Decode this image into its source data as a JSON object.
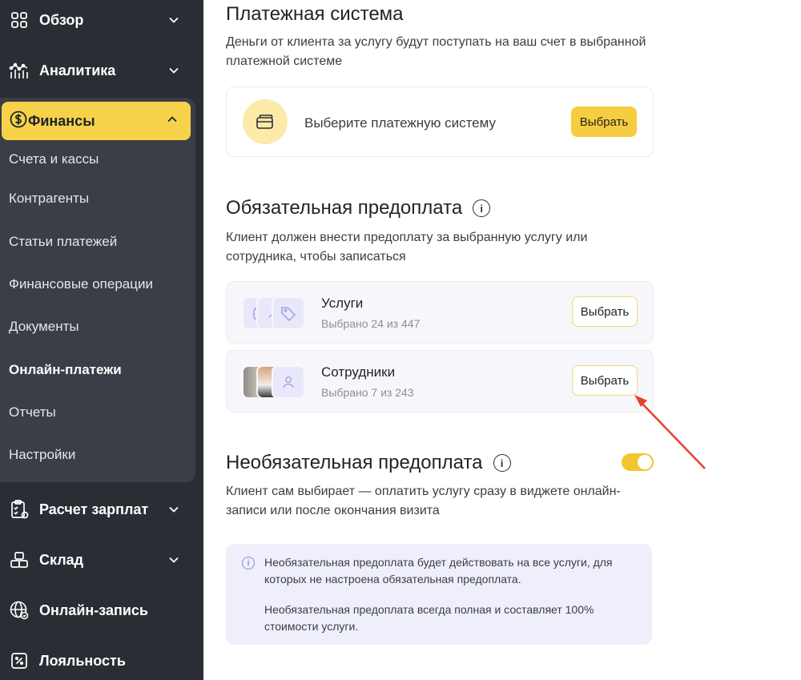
{
  "sidebar": {
    "items": [
      {
        "label": "Обзор",
        "icon": "grid-icon"
      },
      {
        "label": "Аналитика",
        "icon": "analytics-icon"
      },
      {
        "label": "Финансы",
        "icon": "dollar-coin-icon"
      },
      {
        "label": "Расчет зарплат",
        "icon": "clipboard-icon"
      },
      {
        "label": "Склад",
        "icon": "boxes-icon"
      },
      {
        "label": "Онлайн-запись",
        "icon": "globe-icon"
      },
      {
        "label": "Лояльность",
        "icon": "percent-icon"
      }
    ],
    "finance_sub": [
      "Счета и кассы",
      "Контрагенты",
      "Статьи платежей",
      "Финансовые операции",
      "Документы",
      "Онлайн-платежи",
      "Отчеты",
      "Настройки"
    ],
    "active_sub": "Онлайн-платежи"
  },
  "payment_system": {
    "title": "Платежная система",
    "description": "Деньги от клиента за услугу будут поступать на ваш счет в выбранной платежной системе",
    "card_text": "Выберите платежную систему",
    "button": "Выбрать"
  },
  "required_prepay": {
    "title": "Обязательная предоплата",
    "description": "Клиент должен внести предоплату за выбранную услугу или сотрудника, чтобы записаться",
    "rows": [
      {
        "title": "Услуги",
        "subtitle": "Выбрано 24 из 447",
        "button": "Выбрать"
      },
      {
        "title": "Сотрудники",
        "subtitle": "Выбрано 7 из 243",
        "button": "Выбрать"
      }
    ]
  },
  "optional_prepay": {
    "title": "Необязательная предоплата",
    "enabled": true,
    "description": "Клиент сам выбирает — оплатить услугу сразу в виджете онлайн-записи или после окончания визита",
    "note_1": "Необязательная предоплата будет действовать на все услуги, для которых не настроена обязательная предоплата.",
    "note_2": "Необязательная предоплата всегда полная и составляет 100% стоимости услуги."
  },
  "colors": {
    "sidebar_bg": "#2a2d34",
    "accent_yellow": "#f6cd3f",
    "annotation_arrow": "#e8412f"
  }
}
